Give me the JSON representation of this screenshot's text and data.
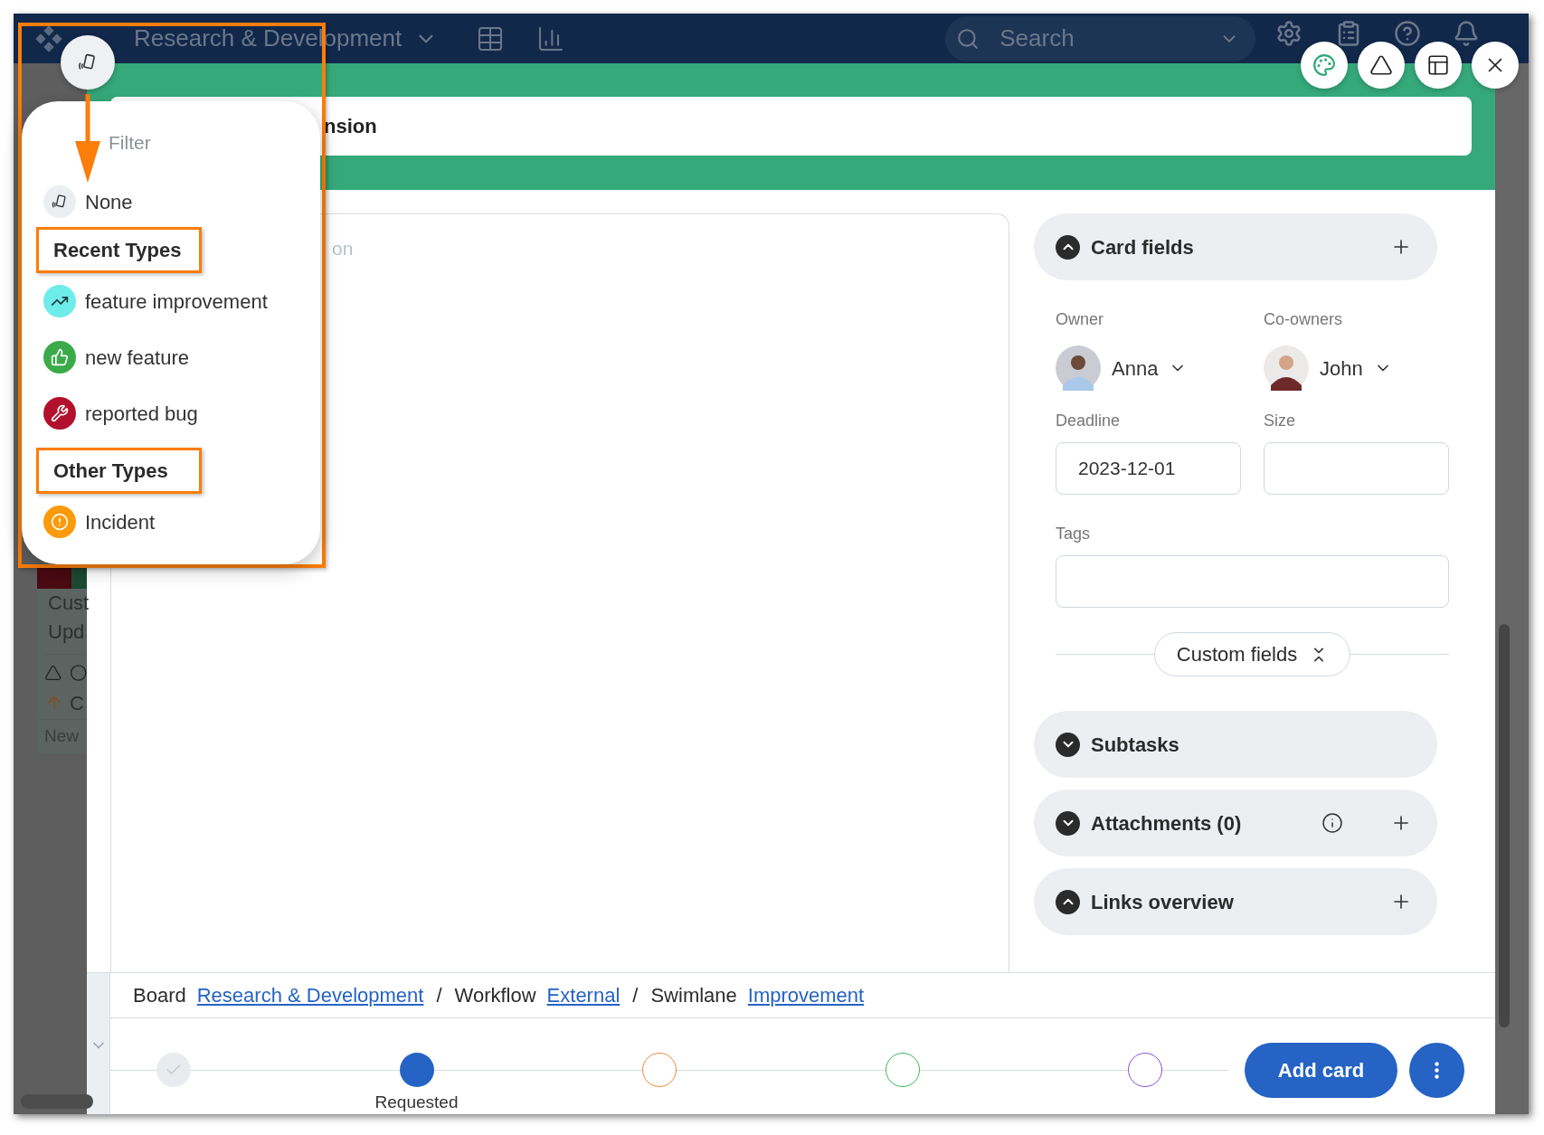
{
  "top_bar": {
    "board_title": "Research & Development",
    "search": {
      "placeholder": "Search"
    }
  },
  "background_card": {
    "title_lines": [
      "Cust",
      "Upd"
    ],
    "owner_text": "C",
    "footer": "New"
  },
  "card_window": {
    "title": "nsion",
    "description_placeholder": "on",
    "header_buttons": [
      {
        "kind": "palette"
      },
      {
        "kind": "triangle"
      },
      {
        "kind": "layout"
      },
      {
        "kind": "close"
      }
    ],
    "card_fields": {
      "title": "Card fields",
      "expanded": true,
      "owner": {
        "label": "Owner",
        "name": "Anna"
      },
      "co_owners": {
        "label": "Co-owners",
        "name": "John"
      },
      "deadline": {
        "label": "Deadline",
        "value": "2023-12-01"
      },
      "size": {
        "label": "Size"
      },
      "tags": {
        "label": "Tags"
      },
      "custom_fields_button": "Custom fields"
    },
    "sections": [
      {
        "title": "Subtasks",
        "expanded": false,
        "info": false,
        "add": false
      },
      {
        "title": "Attachments (0)",
        "expanded": false,
        "info": true,
        "add": true
      },
      {
        "title": "Links overview",
        "expanded": true,
        "info": false,
        "add": true
      }
    ],
    "breadcrumb": [
      {
        "label": "Board",
        "link": "Research & Development"
      },
      {
        "separator": "/",
        "label": "Workflow",
        "link": "External"
      },
      {
        "separator": "/",
        "label": "Swimlane",
        "link": "Improvement"
      }
    ],
    "steps": [
      {
        "kind": "done",
        "color": "#c5cdd4"
      },
      {
        "kind": "current",
        "color": "#2563c4",
        "label": "Requested"
      },
      {
        "kind": "pending",
        "color": "#f0873a"
      },
      {
        "kind": "pending",
        "color": "#3cb55a"
      },
      {
        "kind": "pending",
        "color": "#8a4fd6"
      }
    ],
    "add_card_button": "Add card"
  },
  "type_menu": {
    "filter_placeholder": "Filter",
    "none_option": "None",
    "annotated": true,
    "groups": [
      {
        "heading": "Recent Types",
        "highlighted": true,
        "types": [
          {
            "label": "feature improvement",
            "kind": "trend",
            "color": "#6eecea"
          },
          {
            "label": "new feature",
            "kind": "thumb",
            "color": "#3aab48"
          },
          {
            "label": "reported bug",
            "kind": "wrench",
            "color": "#b3102c"
          }
        ]
      },
      {
        "heading": "Other Types",
        "highlighted": true,
        "types": [
          {
            "label": "Incident",
            "kind": "alert",
            "color": "#fb9a0a"
          }
        ]
      }
    ]
  }
}
